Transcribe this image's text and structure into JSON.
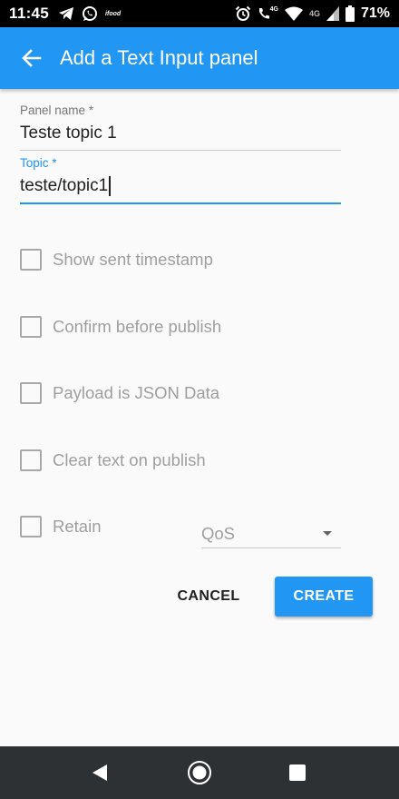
{
  "status_bar": {
    "time": "11:45",
    "left_icons": [
      "telegram-icon",
      "whatsapp-icon",
      "ifood-icon"
    ],
    "ifood_label": "ifood",
    "right_icons": [
      "alarm-icon",
      "volte-call-icon",
      "wifi-icon",
      "signal-icon",
      "battery-icon"
    ],
    "volte_label": "4G",
    "network_label": "4G",
    "battery": "71%"
  },
  "app_bar": {
    "back_icon": "arrow-left-icon",
    "title": "Add a Text Input panel",
    "color": "#2196f3"
  },
  "form": {
    "panel_name": {
      "label": "Panel name",
      "required_mark": "*",
      "value": "Teste topic 1"
    },
    "topic": {
      "label": "Topic",
      "required_mark": "*",
      "value": "teste/topic1",
      "focused": true
    },
    "checkboxes": [
      {
        "label": "Show sent timestamp",
        "checked": false
      },
      {
        "label": "Confirm before publish",
        "checked": false
      },
      {
        "label": "Payload is JSON Data",
        "checked": false
      },
      {
        "label": "Clear text on publish",
        "checked": false
      },
      {
        "label": "Retain",
        "checked": false
      }
    ],
    "qos": {
      "placeholder": "QoS",
      "icon": "dropdown-caret-icon"
    }
  },
  "actions": {
    "cancel_label": "CANCEL",
    "create_label": "CREATE"
  },
  "nav_bar": {
    "icons": [
      "back-triangle-icon",
      "home-circle-icon",
      "recents-square-icon"
    ]
  }
}
